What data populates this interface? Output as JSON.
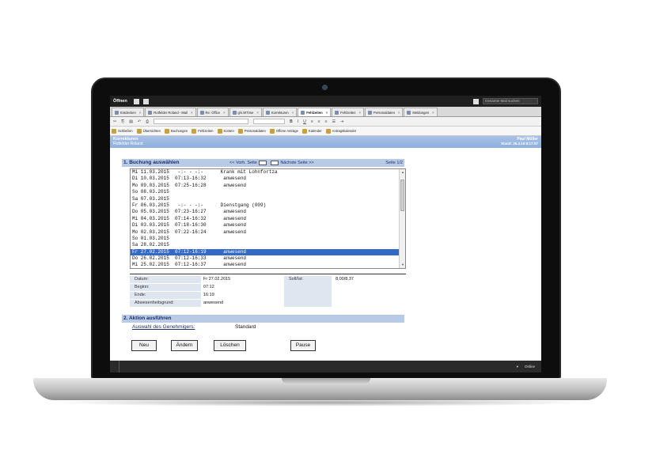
{
  "topbar": {
    "open_label": "Öffnen",
    "search_placeholder": "Gesamte Mail suchen"
  },
  "tabs": [
    {
      "label": "Entdecken"
    },
    {
      "label": "Rotfelder Roland - Mail"
    },
    {
      "label": "Re: Office"
    },
    {
      "label": "g/s.WTime"
    },
    {
      "label": "Korrekturen"
    },
    {
      "label": "Fehlzeiten",
      "active": true
    },
    {
      "label": "Fehlzeiten"
    },
    {
      "label": "Personaldaten"
    },
    {
      "label": "Meldungen"
    }
  ],
  "navbar": {
    "items": [
      "Schließen",
      "Übersichten",
      "Buchungen",
      "Fehlzeiten",
      "Konten",
      "Personaldaten",
      "Offene Anträge",
      "Kalender",
      "Antragskalender"
    ]
  },
  "header": {
    "title": "Korrekturen",
    "subtitle": "Rotfelder Roland",
    "user": "Paul Müller",
    "stand": "Stand: 25.3.15 8:17:07"
  },
  "section1": {
    "title": "1. Buchung auswählen",
    "prev": "<< Vorh. Seite",
    "next": "Nächste Seite >>",
    "page": "Seite 1/2"
  },
  "bookings": [
    "Mi 11.03.2015   -:- - -:-      Krank mit Lohnfortza",
    "Di 10.03.2015  07:13-16:32      anwesend",
    "Mo 09.03.2015  07:25-16:28      anwesend",
    "So 08.03.2015",
    "Sa 07.03.2015",
    "Fr 06.03.2015   -:- - -:-      Dienstgang (009)",
    "Do 05.03.2015  07:23-16:27      anwesend",
    "Mi 04.03.2015  07:14-16:32      anwesend",
    "Di 03.03.2015  07:18-16:30      anwesend",
    "Mo 02.03.2015  07:22-16:24      anwesend",
    "So 01.03.2015",
    "Sa 28.02.2015",
    "Fr 27.02.2015  07:12-16:19      anwesend",
    "Do 26.02.2015  07:12-16:33      anwesend",
    "Mi 25.02.2015  07:12-16:37      anwesend"
  ],
  "selected_index": 12,
  "details": {
    "datum_label": "Datum:",
    "datum_value": "Fr 27.02.2015",
    "beginn_label": "Beginn:",
    "beginn_value": "07:12",
    "ende_label": "Ende:",
    "ende_value": "16:19",
    "abw_label": "Abwesenheitsgrund:",
    "abw_value": "anwesend",
    "soll_label": "Soll/Ist:",
    "soll_value": "8,00/8,37"
  },
  "section2": {
    "title": "2. Aktion ausführen",
    "approver_label": "Auswahl des Genehmigers:",
    "approver_value": "Standard"
  },
  "buttons": {
    "new": "Neu",
    "change": "Ändern",
    "delete": "Löschen",
    "pause": "Pause"
  },
  "statusbar": {
    "online": "Online"
  }
}
